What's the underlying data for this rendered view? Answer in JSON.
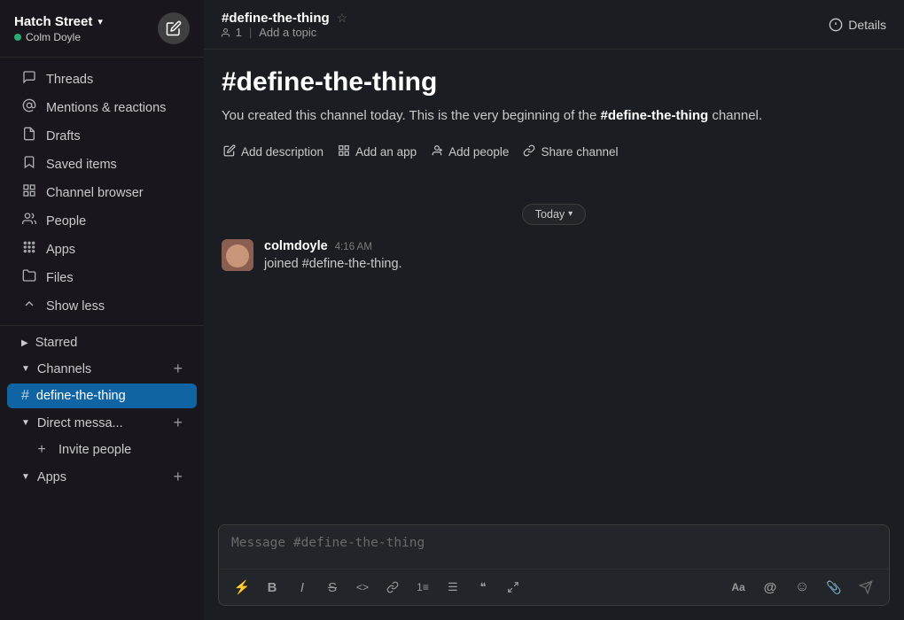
{
  "workspace": {
    "name": "Hatch Street",
    "user": "Colm Doyle",
    "status": "active"
  },
  "sidebar": {
    "nav_items": [
      {
        "id": "threads",
        "label": "Threads",
        "icon": "⊡"
      },
      {
        "id": "mentions",
        "label": "Mentions & reactions",
        "icon": "◉"
      },
      {
        "id": "drafts",
        "label": "Drafts",
        "icon": "⊟"
      },
      {
        "id": "saved",
        "label": "Saved items",
        "icon": "🔖"
      },
      {
        "id": "channels",
        "label": "Channel browser",
        "icon": "⊞"
      },
      {
        "id": "people",
        "label": "People",
        "icon": "◎"
      },
      {
        "id": "apps",
        "label": "Apps",
        "icon": "⊞"
      },
      {
        "id": "files",
        "label": "Files",
        "icon": "⊟"
      },
      {
        "id": "show_less",
        "label": "Show less",
        "icon": "↑"
      }
    ],
    "sections": {
      "starred": {
        "label": "Starred",
        "collapsed": true
      },
      "channels": {
        "label": "Channels",
        "collapsed": false,
        "items": [
          {
            "id": "define-the-thing",
            "label": "define-the-thing",
            "active": true
          }
        ]
      },
      "direct_messages": {
        "label": "Direct messa...",
        "collapsed": false,
        "items": [
          {
            "id": "invite",
            "label": "Invite people"
          }
        ]
      },
      "apps": {
        "label": "Apps",
        "collapsed": false,
        "items": []
      }
    }
  },
  "channel": {
    "name": "#define-the-thing",
    "display_name": "#define-the-thing",
    "member_count": 1,
    "topic_placeholder": "Add a topic",
    "details_label": "Details",
    "intro_title": "#define-the-thing",
    "intro_desc_prefix": "You created this channel today. This is the very beginning of the ",
    "intro_desc_channel": "#define-the-thing",
    "intro_desc_suffix": " channel.",
    "actions": [
      {
        "id": "add_description",
        "icon": "✏",
        "label": "Add description"
      },
      {
        "id": "add_app",
        "icon": "⊞",
        "label": "Add an app"
      },
      {
        "id": "add_people",
        "icon": "👤",
        "label": "Add people"
      },
      {
        "id": "share_channel",
        "icon": "🔗",
        "label": "Share channel"
      }
    ]
  },
  "date_divider": {
    "label": "Today",
    "chevron": "▾"
  },
  "message": {
    "author": "colmdoyle",
    "time": "4:16 AM",
    "text": "joined #define-the-thing."
  },
  "message_input": {
    "placeholder": "Message #define-the-thing"
  },
  "toolbar": {
    "buttons": [
      {
        "id": "lightning",
        "icon": "⚡"
      },
      {
        "id": "bold",
        "icon": "B"
      },
      {
        "id": "italic",
        "icon": "I"
      },
      {
        "id": "strikethrough",
        "icon": "S"
      },
      {
        "id": "code",
        "icon": "<>"
      },
      {
        "id": "link",
        "icon": "🔗"
      },
      {
        "id": "ordered_list",
        "icon": "≡"
      },
      {
        "id": "bullet_list",
        "icon": "☰"
      },
      {
        "id": "block_quote",
        "icon": "❝"
      },
      {
        "id": "more",
        "icon": "⟲"
      }
    ],
    "right_buttons": [
      {
        "id": "text_format",
        "icon": "Aa"
      },
      {
        "id": "mention",
        "icon": "@"
      },
      {
        "id": "emoji",
        "icon": "☺"
      },
      {
        "id": "attachment",
        "icon": "📎"
      }
    ]
  }
}
